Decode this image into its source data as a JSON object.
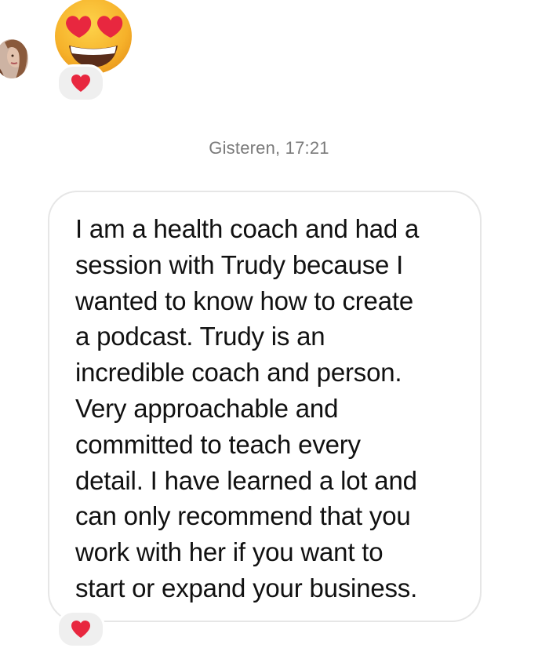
{
  "thread": {
    "timestamp": "Gisteren, 17:21",
    "message": {
      "text": "I am a health coach and had a\nsession with Trudy because I\nwanted to know how to create\na podcast. Trudy is an\nincredible coach and person.\nVery approachable and\ncommitted to teach every\ndetail. I have learned a lot and\ncan only recommend that you\nwork with her if you want to\nstart or expand your business."
    },
    "emoji_message": {
      "icon": "heart-eyes-emoji-icon",
      "reaction_icon": "red-heart-icon"
    },
    "message_reaction_icon": "red-heart-icon"
  },
  "colors": {
    "bubble_border": "#e6e6e6",
    "reaction_bg": "#efefef",
    "timestamp": "#7a7a7a",
    "heart": "#e8273f",
    "emoji_face": "#f8b52a"
  }
}
